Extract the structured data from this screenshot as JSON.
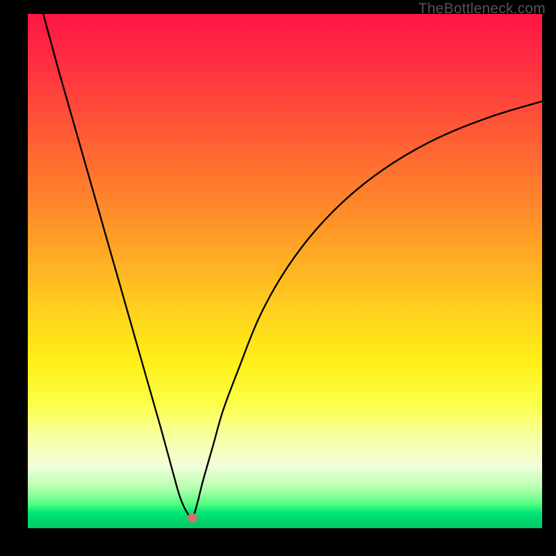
{
  "domain": "Chart",
  "watermark": "TheBottleneck.com",
  "chart_data": {
    "type": "line",
    "title": "",
    "xlabel": "",
    "ylabel": "",
    "xlim": [
      0,
      100
    ],
    "ylim": [
      0,
      100
    ],
    "grid": false,
    "legend": false,
    "marker": {
      "x_pct": 32,
      "y_pct": 2
    },
    "series": [
      {
        "name": "left-branch",
        "x_pct": [
          3,
          6,
          10,
          14,
          18,
          22,
          26,
          29,
          30,
          31,
          32
        ],
        "y_pct": [
          100,
          89,
          75,
          61,
          47,
          33,
          19,
          8,
          5,
          3,
          2
        ]
      },
      {
        "name": "right-branch",
        "x_pct": [
          32,
          33,
          34,
          36,
          38,
          41,
          45,
          50,
          56,
          63,
          71,
          80,
          90,
          100
        ],
        "y_pct": [
          2,
          5,
          9,
          16,
          23,
          31,
          41,
          50,
          58,
          65,
          71,
          76,
          80,
          83
        ]
      }
    ],
    "gradient_colors": [
      "#ff1545",
      "#ff2a42",
      "#ff4a3a",
      "#ff6a32",
      "#ff8a2a",
      "#ffae24",
      "#ffd21e",
      "#fff018",
      "#fbff4a",
      "#f8ffa0",
      "#f0ffd8",
      "#b8ffb0",
      "#60ff88",
      "#00e878",
      "#00d870",
      "#00c868"
    ]
  }
}
